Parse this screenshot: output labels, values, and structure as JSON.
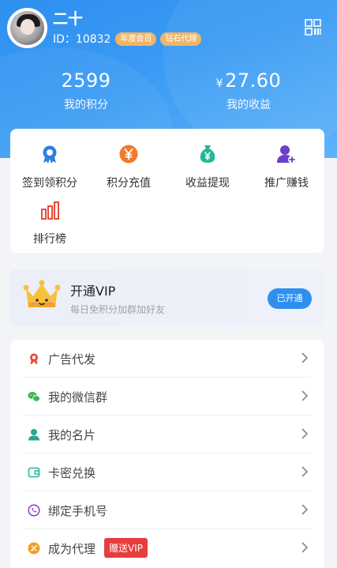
{
  "profile": {
    "username": "二十",
    "id_text": "ID：10832",
    "badges": [
      "年度会员",
      "钻石代理"
    ]
  },
  "stats": {
    "points_value": "2599",
    "points_label": "我的积分",
    "income_currency": "¥",
    "income_value": "27.60",
    "income_label": "我的收益"
  },
  "grid": [
    {
      "label": "签到领积分",
      "icon": "award-icon",
      "color": "#2f7ee6"
    },
    {
      "label": "积分充值",
      "icon": "yen-coin-icon",
      "color": "#f07a2a"
    },
    {
      "label": "收益提现",
      "icon": "money-bag-icon",
      "color": "#26b59a"
    },
    {
      "label": "推广赚钱",
      "icon": "add-user-icon",
      "color": "#6b3fc8"
    },
    {
      "label": "排行榜",
      "icon": "bar-chart-icon",
      "color": "#e64a3b"
    }
  ],
  "vip": {
    "title": "开通VIP",
    "subtitle": "每日免积分加群加好友",
    "button": "已开通"
  },
  "menu": [
    {
      "label": "广告代发",
      "icon": "ribbon-icon",
      "color": "#e64a3b"
    },
    {
      "label": "我的微信群",
      "icon": "wechat-icon",
      "color": "#3cb64a"
    },
    {
      "label": "我的名片",
      "icon": "user-icon",
      "color": "#22a98c"
    },
    {
      "label": "卡密兑换",
      "icon": "wallet-icon",
      "color": "#26b59a"
    },
    {
      "label": "绑定手机号",
      "icon": "phone-icon",
      "color": "#8a3fc8"
    },
    {
      "label": "成为代理",
      "icon": "agent-icon",
      "color": "#f0a02a",
      "tag": "赠送VIP"
    }
  ]
}
